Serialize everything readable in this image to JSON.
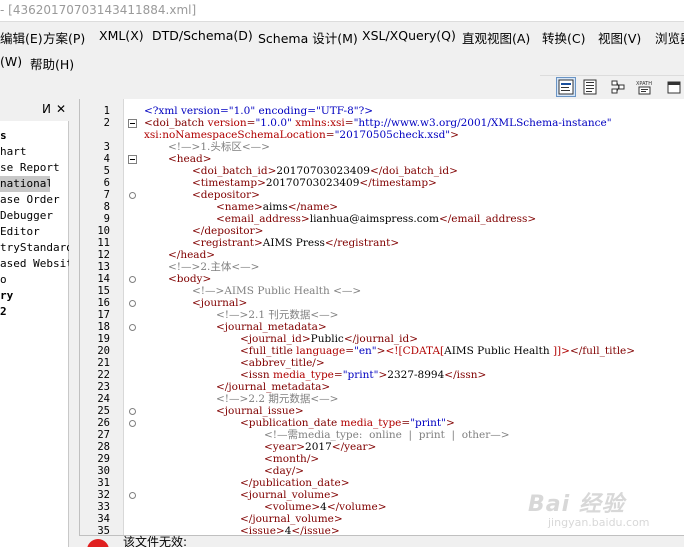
{
  "window": {
    "title": "- [43620170703143411884.xml]"
  },
  "menu": {
    "row1": [
      "编辑(E)",
      "方案(P)",
      "XML(X)",
      "DTD/Schema(D)",
      "Schema 设计(M)",
      "XSL/XQuery(Q)",
      "直观视图(A)",
      "转换(C)",
      "视图(V)",
      "浏览器"
    ],
    "row2": [
      "(W)",
      "帮助(H)"
    ]
  },
  "toolbar": {
    "buttons": [
      "text-view-icon",
      "grid-view-icon",
      "schema-view-icon",
      "xpath-icon",
      "browser-view-icon"
    ],
    "xpath_label": "XPATH"
  },
  "left_panel": {
    "pin": "ⵍ",
    "close": "✕",
    "items": [
      {
        "text": "s",
        "bold": true
      },
      {
        "text": "hart",
        "bold": false
      },
      {
        "text": "se Report",
        "bold": false
      },
      {
        "text": "national",
        "bold": false,
        "selected": true
      },
      {
        "text": "ase Order",
        "bold": false
      },
      {
        "text": "Debugger",
        "bold": false
      },
      {
        "text": "Editor",
        "bold": false
      },
      {
        "text": "tryStandard",
        "bold": false
      },
      {
        "text": "ased Websit",
        "bold": false
      },
      {
        "text": "o",
        "bold": false
      },
      {
        "text": "ry",
        "bold": true
      },
      {
        "text": "2",
        "bold": true
      }
    ]
  },
  "editor": {
    "lines": [
      {
        "n": "1",
        "i": 0,
        "html": "<span class='pi'>&lt;?xml version=\"1.0\" encoding=\"UTF-8\"?&gt;</span>"
      },
      {
        "n": "2",
        "i": 0,
        "html": "&lt;doi_batch <span class='attr'>version</span>=<span class='val'>\"1.0.0\"</span> <span class='attr'>xmlns:xsi</span>=<span class='val'>\"http://www.w3.org/2001/XMLSchema-instance\"</span>",
        "fold": "minus"
      },
      {
        "n": "",
        "i": -1,
        "html": "<span class='attr'>xsi:noNamespaceSchemaLocation</span>=<span class='val'>\"20170505check.xsd\"</span>&gt;"
      },
      {
        "n": "3",
        "i": 1,
        "html": "<span class='cmt'>&lt;!—&gt;1.头标区&lt;—&gt;</span>"
      },
      {
        "n": "4",
        "i": 1,
        "html": "&lt;head&gt;",
        "fold": "minus"
      },
      {
        "n": "5",
        "i": 2,
        "html": "&lt;doi_batch_id&gt;<span class='txt'>20170703023409</span>&lt;/doi_batch_id&gt;"
      },
      {
        "n": "6",
        "i": 2,
        "html": "&lt;timestamp&gt;<span class='txt'>20170703023409</span>&lt;/timestamp&gt;"
      },
      {
        "n": "7",
        "i": 2,
        "html": "&lt;depositor&gt;",
        "fold": "circle"
      },
      {
        "n": "8",
        "i": 3,
        "html": "&lt;name&gt;<span class='txt'>aims</span>&lt;/name&gt;"
      },
      {
        "n": "9",
        "i": 3,
        "html": "&lt;email_address&gt;<span class='txt'>lianhua@aimspress.com</span>&lt;/email_address&gt;"
      },
      {
        "n": "10",
        "i": 2,
        "html": "&lt;/depositor&gt;"
      },
      {
        "n": "11",
        "i": 2,
        "html": "&lt;registrant&gt;<span class='txt'>AIMS Press</span>&lt;/registrant&gt;"
      },
      {
        "n": "12",
        "i": 1,
        "html": "&lt;/head&gt;"
      },
      {
        "n": "13",
        "i": 1,
        "html": "<span class='cmt'>&lt;!—&gt;2.主体&lt;—&gt;</span>"
      },
      {
        "n": "14",
        "i": 1,
        "html": "&lt;body&gt;",
        "fold": "circle"
      },
      {
        "n": "15",
        "i": 2,
        "html": "<span class='cmt'>&lt;!—&gt;AIMS Public Health &lt;—&gt;</span>"
      },
      {
        "n": "16",
        "i": 2,
        "html": "&lt;journal&gt;",
        "fold": "circle"
      },
      {
        "n": "17",
        "i": 3,
        "html": "<span class='cmt'>&lt;!—&gt;2.1 刊元数据&lt;—&gt;</span>"
      },
      {
        "n": "18",
        "i": 3,
        "html": "&lt;journal_metadata&gt;",
        "fold": "circle"
      },
      {
        "n": "19",
        "i": 4,
        "html": "&lt;journal_id&gt;<span class='txt'>Public</span>&lt;/journal_id&gt;"
      },
      {
        "n": "20",
        "i": 4,
        "html": "&lt;full_title <span class='attr'>language</span>=<span class='val'>\"en\"</span>&gt;<span class='cdata'>&lt;![CDATA[</span><span class='txt'>AIMS Public Health </span><span class='cdata'>]]&gt;</span>&lt;/full_title&gt;"
      },
      {
        "n": "21",
        "i": 4,
        "html": "&lt;abbrev_title/&gt;"
      },
      {
        "n": "22",
        "i": 4,
        "html": "&lt;issn <span class='attr'>media_type</span>=<span class='val'>\"print\"</span>&gt;<span class='txt'>2327-8994</span>&lt;/issn&gt;"
      },
      {
        "n": "23",
        "i": 3,
        "html": "&lt;/journal_metadata&gt;"
      },
      {
        "n": "24",
        "i": 3,
        "html": "<span class='cmt'>&lt;!—&gt;2.2 期元数据&lt;—&gt;</span>"
      },
      {
        "n": "25",
        "i": 3,
        "html": "&lt;journal_issue&gt;",
        "fold": "circle"
      },
      {
        "n": "26",
        "i": 4,
        "html": "&lt;publication_date <span class='attr'>media_type</span>=<span class='val'>\"print\"</span>&gt;",
        "fold": "circle"
      },
      {
        "n": "27",
        "i": 5,
        "html": "<span class='cmt'>&lt;!—需media_type:  online  |  print  |  other—&gt;</span>"
      },
      {
        "n": "28",
        "i": 5,
        "html": "&lt;year&gt;<span class='txt'>2017</span>&lt;/year&gt;"
      },
      {
        "n": "29",
        "i": 5,
        "html": "&lt;month/&gt;"
      },
      {
        "n": "30",
        "i": 5,
        "html": "&lt;day/&gt;"
      },
      {
        "n": "31",
        "i": 4,
        "html": "&lt;/publication_date&gt;"
      },
      {
        "n": "32",
        "i": 4,
        "html": "&lt;journal_volume&gt;",
        "fold": "circle"
      },
      {
        "n": "33",
        "i": 5,
        "html": "&lt;volume&gt;<span class='txt'>4</span>&lt;/volume&gt;"
      },
      {
        "n": "34",
        "i": 4,
        "html": "&lt;/journal_volume&gt;"
      },
      {
        "n": "35",
        "i": 4,
        "html": "&lt;issue&gt;<span class='txt'>4</span>&lt;/issue&gt;"
      }
    ]
  },
  "status": {
    "message": "该文件无效:"
  },
  "watermark": {
    "brand": "Bai 经验",
    "url": "jingyan.baidu.com"
  }
}
